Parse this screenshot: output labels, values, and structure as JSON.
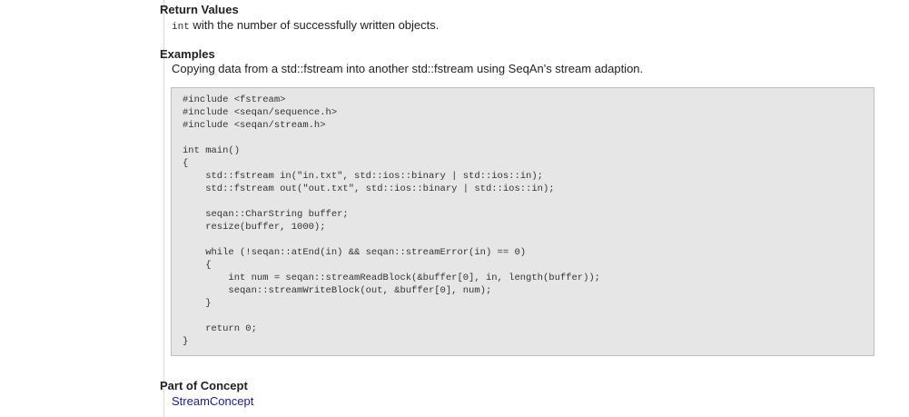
{
  "return_values": {
    "title": "Return Values",
    "type": "int",
    "description": " with the number of successfully written objects."
  },
  "examples": {
    "title": "Examples",
    "description": "Copying data from a std::fstream into another std::fstream using SeqAn's stream adaption.",
    "code": "#include <fstream>\n#include <seqan/sequence.h>\n#include <seqan/stream.h>\n\nint main()\n{\n    std::fstream in(\"in.txt\", std::ios::binary | std::ios::in);\n    std::fstream out(\"out.txt\", std::ios::binary | std::ios::in);\n\n    seqan::CharString buffer;\n    resize(buffer, 1000);\n\n    while (!seqan::atEnd(in) && seqan::streamError(in) == 0)\n    {\n        int num = seqan::streamReadBlock(&buffer[0], in, length(buffer));\n        seqan::streamWriteBlock(out, &buffer[0], num);\n    }\n\n    return 0;\n}"
  },
  "part_of_concept": {
    "title": "Part of Concept",
    "link_label": "StreamConcept"
  }
}
